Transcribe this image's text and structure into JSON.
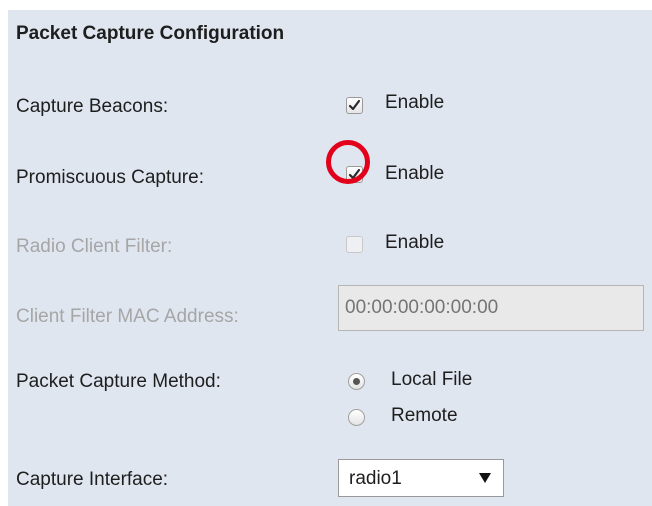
{
  "section": {
    "title": "Packet Capture Configuration"
  },
  "capture_beacons": {
    "label": "Capture Beacons:",
    "option_label": "Enable",
    "checked": true
  },
  "promiscuous_capture": {
    "label": "Promiscuous Capture:",
    "option_label": "Enable",
    "checked": true,
    "highlighted": true,
    "highlight_color": "#e2001a"
  },
  "radio_client_filter": {
    "label": "Radio Client Filter:",
    "option_label": "Enable",
    "checked": false,
    "disabled": true
  },
  "client_filter_mac": {
    "label": "Client Filter MAC Address:",
    "placeholder": "00:00:00:00:00:00",
    "disabled": true
  },
  "capture_method": {
    "label": "Packet Capture Method:",
    "options": [
      {
        "label": "Local File",
        "selected": true
      },
      {
        "label": "Remote",
        "selected": false
      }
    ]
  },
  "capture_interface": {
    "label": "Capture Interface:",
    "selected_value": "radio1"
  },
  "colors": {
    "panel_background": "#dfe6f0",
    "text": "#1e1e1e",
    "disabled_text": "#a6a6a6"
  }
}
